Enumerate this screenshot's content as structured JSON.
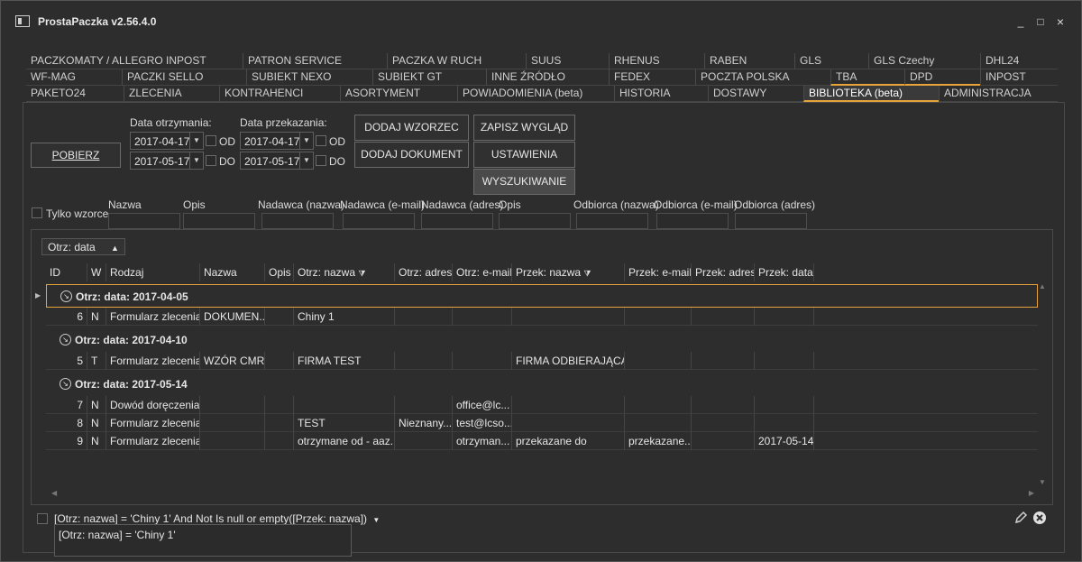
{
  "app": {
    "title": "ProstaPaczka v2.56.4.0"
  },
  "window_buttons": {
    "minimize": "_",
    "maximize": "□",
    "close": "×"
  },
  "tabs": {
    "row1": [
      "PACZKOMATY / ALLEGRO INPOST",
      "PATRON SERVICE",
      "PACZKA W RUCH",
      "SUUS",
      "RHENUS",
      "RABEN",
      "GLS",
      "GLS Czechy",
      "DHL24"
    ],
    "row2": [
      "WF-MAG",
      "PACZKI SELLO",
      "SUBIEKT NEXO",
      "SUBIEKT GT",
      "INNE ŹRÓDŁO",
      "FEDEX",
      "POCZTA POLSKA",
      "TBA",
      "DPD",
      "INPOST"
    ],
    "row3": [
      "PAKETO24",
      "ZLECENIA",
      "KONTRAHENCI",
      "ASORTYMENT",
      "POWIADOMIENIA (beta)",
      "HISTORIA",
      "DOSTAWY",
      "BIBLIOTEKA (beta)",
      "ADMINISTRACJA"
    ]
  },
  "toolbar": {
    "pobierz": "POBIERZ",
    "data_otrzymania_label": "Data otrzymania:",
    "data_przekazania_label": "Data przekazania:",
    "otrz_od": "2017-04-17",
    "otrz_do": "2017-05-17",
    "przek_od": "2017-04-17",
    "przek_do": "2017-05-17",
    "od_label": "OD",
    "do_label": "DO",
    "dodaj_wzorzec": "DODAJ WZORZEC",
    "dodaj_dokument": "DODAJ DOKUMENT",
    "zapisz_wyglad": "ZAPISZ WYGLĄD",
    "ustawienia": "USTAWIENIA",
    "wyszukiwanie": "WYSZUKIWANIE"
  },
  "filters": {
    "tylko_wzorce": "Tylko wzorce",
    "labels": [
      "Nazwa",
      "Opis",
      "Nadawca (nazwa)",
      "Nadawca (e-mail)",
      "Nadawca (adres)",
      "Opis",
      "Odbiorca (nazwa)",
      "Odbiorca (e-mail)",
      "Odbiorca (adres)"
    ]
  },
  "grid": {
    "groupby": "Otrz: data",
    "columns": [
      "ID",
      "W",
      "Rodzaj",
      "Nazwa",
      "Opis",
      "Otrz: nazwa",
      "Otrz: adres",
      "Otrz: e-mail",
      "Przek: nazwa",
      "Przek: e-mail",
      "Przek: adres",
      "Przek: data"
    ],
    "groups": [
      {
        "label": "Otrz: data: 2017-04-05",
        "rows": [
          {
            "id": "6",
            "w": "N",
            "rodzaj": "Formularz zlecenia",
            "nazwa": "DOKUMEN...",
            "opis": "",
            "otrz_nazwa": "Chiny 1",
            "otrz_adres": "",
            "otrz_email": "",
            "przek_nazwa": "",
            "przek_email": "",
            "przek_adres": "",
            "przek_data": ""
          }
        ]
      },
      {
        "label": "Otrz: data: 2017-04-10",
        "rows": [
          {
            "id": "5",
            "w": "T",
            "rodzaj": "Formularz zlecenia",
            "nazwa": "WZÓR CMR",
            "opis": "",
            "otrz_nazwa": "FIRMA TEST",
            "otrz_adres": "",
            "otrz_email": "",
            "przek_nazwa": "FIRMA ODBIERAJĄCA",
            "przek_email": "",
            "przek_adres": "",
            "przek_data": ""
          }
        ]
      },
      {
        "label": "Otrz: data: 2017-05-14",
        "rows": [
          {
            "id": "7",
            "w": "N",
            "rodzaj": "Dowód doręczenia",
            "nazwa": "",
            "opis": "",
            "otrz_nazwa": "",
            "otrz_adres": "",
            "otrz_email": "office@lc...",
            "przek_nazwa": "",
            "przek_email": "",
            "przek_adres": "",
            "przek_data": ""
          },
          {
            "id": "8",
            "w": "N",
            "rodzaj": "Formularz zlecenia",
            "nazwa": "",
            "opis": "",
            "otrz_nazwa": "TEST",
            "otrz_adres": "Nieznany...",
            "otrz_email": "test@lcso...",
            "przek_nazwa": "",
            "przek_email": "",
            "przek_adres": "",
            "przek_data": ""
          },
          {
            "id": "9",
            "w": "N",
            "rodzaj": "Formularz zlecenia",
            "nazwa": "",
            "opis": "",
            "otrz_nazwa": "otrzymane od - aaz...",
            "otrz_adres": "",
            "otrz_email": "otrzyman...",
            "przek_nazwa": "przekazane do",
            "przek_email": "przekazane...",
            "przek_adres": "",
            "przek_data": "2017-05-14"
          }
        ]
      }
    ]
  },
  "filter_bar": {
    "expression": "[Otrz: nazwa] = 'Chiny 1' And Not Is null or empty([Przek: nazwa])",
    "popup_item": "[Otrz: nazwa] = 'Chiny 1'"
  },
  "colors": {
    "accent": "#e8a33a",
    "background": "#2d2d2d"
  }
}
